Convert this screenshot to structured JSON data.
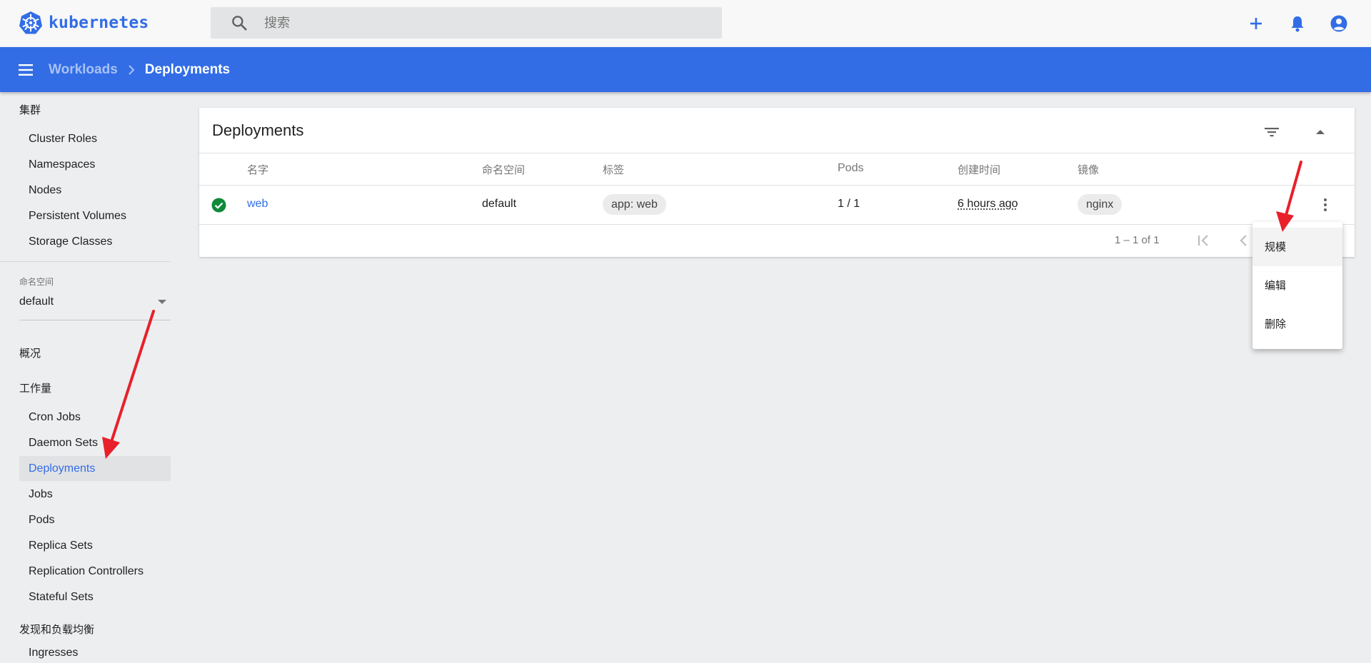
{
  "app": {
    "brand": "kubernetes",
    "brand_color": "#326de6"
  },
  "search": {
    "placeholder": "搜索"
  },
  "header": {
    "breadcrumb": [
      {
        "label": "Workloads"
      },
      {
        "label": "Deployments"
      }
    ]
  },
  "sidebar": {
    "cluster_section": "集群",
    "cluster_items": [
      "Cluster Roles",
      "Namespaces",
      "Nodes",
      "Persistent Volumes",
      "Storage Classes"
    ],
    "namespace_label": "命名空间",
    "namespace_value": "default",
    "overview": "概况",
    "workloads_section": "工作量",
    "workload_items": [
      "Cron Jobs",
      "Daemon Sets",
      "Deployments",
      "Jobs",
      "Pods",
      "Replica Sets",
      "Replication Controllers",
      "Stateful Sets"
    ],
    "active_item": "Deployments",
    "discovery_section": "发现和负载均衡",
    "discovery_items": [
      "Ingresses"
    ]
  },
  "card": {
    "title": "Deployments",
    "columns": [
      "名字",
      "命名空间",
      "标签",
      "Pods",
      "创建时间",
      "镜像"
    ],
    "rows": [
      {
        "status": "ok",
        "name": "web",
        "namespace": "default",
        "labels": "app: web",
        "pods": "1 / 1",
        "created": "6 hours ago",
        "image": "nginx"
      }
    ],
    "pagination": {
      "range": "1 – 1 of 1"
    }
  },
  "row_menu": {
    "items": [
      "规模",
      "编辑",
      "删除"
    ]
  },
  "colors": {
    "accent": "#326de6",
    "status_ok": "#0f8a3a",
    "annotation": "#e8202a"
  }
}
